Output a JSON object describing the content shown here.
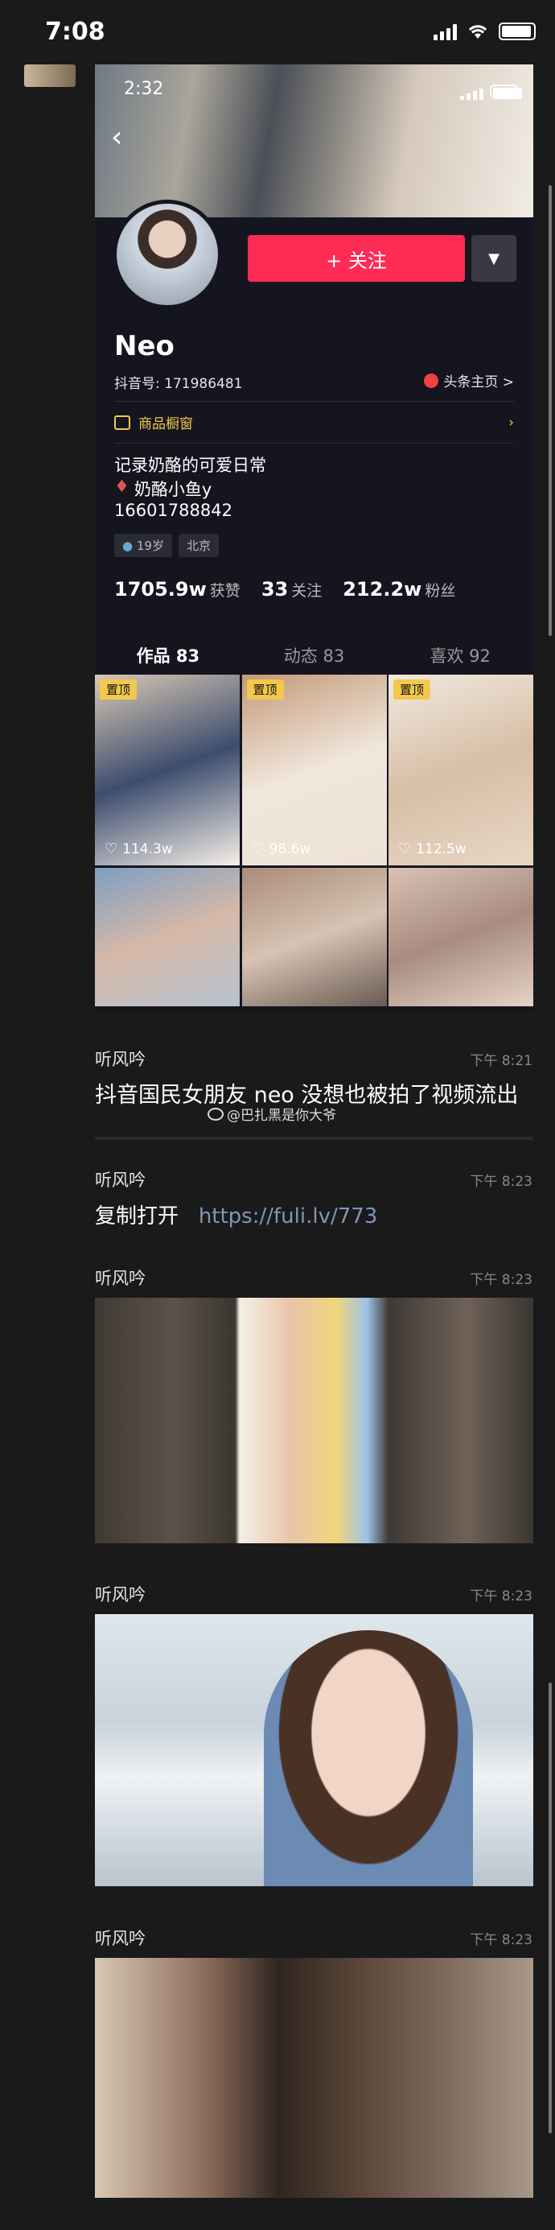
{
  "status_bar": {
    "time": "7:08"
  },
  "profile_card": {
    "inner_time": "2:32",
    "follow_label": "+ 关注",
    "name": "Neo",
    "douyin_id": "抖音号: 171986481",
    "toutiao_label": "头条主页 >",
    "shop_label": "商品橱窗",
    "bio_lines": [
      "记录奶酪的可爱日常",
      "奶酪小鱼y",
      "16601788842"
    ],
    "tags": [
      "19岁",
      "北京"
    ],
    "stats": [
      {
        "value": "1705.9w",
        "label": "获赞"
      },
      {
        "value": "33",
        "label": "关注"
      },
      {
        "value": "212.2w",
        "label": "粉丝"
      }
    ],
    "tabs": [
      "作品 83",
      "动态 83",
      "喜欢 92"
    ],
    "videos": [
      {
        "pinned": "置顶",
        "likes": "114.3w",
        "colors": [
          "#d9c9b5",
          "#3d4d6e",
          "#f5efe8"
        ]
      },
      {
        "pinned": "置顶",
        "likes": "98.6w",
        "colors": [
          "#c49a78",
          "#f0e6dc",
          "#ede2d5"
        ]
      },
      {
        "pinned": "置顶",
        "likes": "112.5w",
        "colors": [
          "#f1e9e0",
          "#d7bfa6",
          "#e8d7c5"
        ]
      },
      {
        "colors": [
          "#7e9ec2",
          "#d6b9a8",
          "#b7c3d0"
        ]
      },
      {
        "colors": [
          "#ab8c78",
          "#d6c3b3",
          "#6a5a52"
        ]
      },
      {
        "colors": [
          "#d9c1b3",
          "#a88c80",
          "#e5d3c6"
        ]
      }
    ]
  },
  "messages": [
    {
      "sender": "听风吟",
      "time": "下午 8:21",
      "text": "抖音国民女朋友 neo 没想也被拍了视频流出"
    },
    {
      "sender": "听风吟",
      "time": "下午 8:23",
      "text_prefix": "复制打开",
      "link": "https://fuli.lv/773"
    },
    {
      "sender": "听风吟",
      "time": "下午 8:23"
    },
    {
      "sender": "听风吟",
      "time": "下午 8:23"
    },
    {
      "sender": "听风吟",
      "time": "下午 8:23"
    }
  ],
  "watermark": "@巴扎黑是你大爷"
}
